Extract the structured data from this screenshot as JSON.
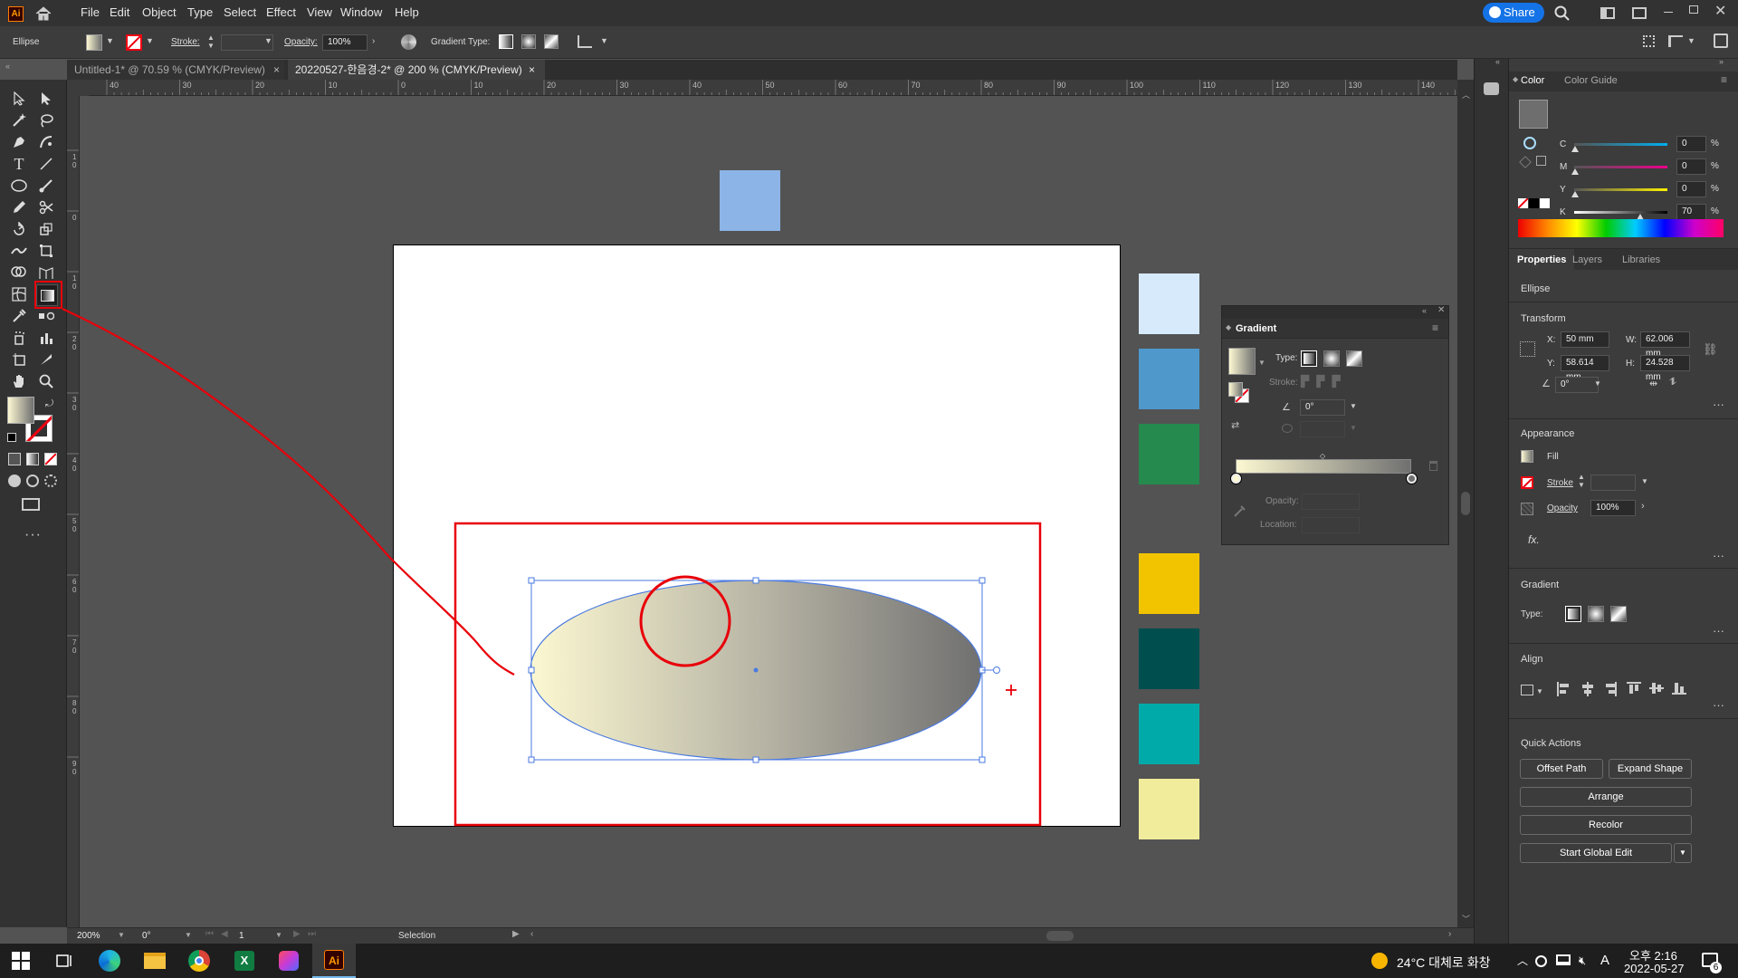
{
  "app": {
    "logo": "Ai",
    "doc_name": "Ellipse"
  },
  "menu": [
    "File",
    "Edit",
    "Object",
    "Type",
    "Select",
    "Effect",
    "View",
    "Window",
    "Help"
  ],
  "share_label": "Share",
  "control": {
    "object": "Ellipse",
    "stroke_label": "Stroke:",
    "opacity_label": "Opacity:",
    "opacity_value": "100%",
    "gradient_type_label": "Gradient Type:"
  },
  "tabs": [
    {
      "label": "Untitled-1* @ 70.59 % (CMYK/Preview)",
      "close": "×"
    },
    {
      "label": "20220527-한음경-2* @ 200 % (CMYK/Preview)",
      "close": "×"
    }
  ],
  "ruler_h": [
    "40",
    "30",
    "20",
    "10",
    "0",
    "10",
    "20",
    "30",
    "40",
    "50",
    "60",
    "70",
    "80",
    "90",
    "100",
    "110",
    "120",
    "130",
    "140"
  ],
  "ruler_v": [
    "1\n0",
    "0",
    "1\n0",
    "2\n0",
    "3\n0",
    "4\n0",
    "5\n0",
    "6\n0",
    "7\n0",
    "8\n0",
    "9\n0"
  ],
  "swatches": [
    "#8cb4e6",
    "#d6eafc",
    "#4e98cc",
    "#258a4e",
    "#f2c400",
    "#004e4e",
    "#00aaa8",
    "#f0ec9c"
  ],
  "gradient_panel": {
    "title": "Gradient",
    "type_label": "Type:",
    "stroke_label": "Stroke:",
    "angle_value": "0°",
    "opacity_label": "Opacity:",
    "location_label": "Location:",
    "start_color": "#fcf8d2",
    "end_color": "#707070"
  },
  "status": {
    "zoom": "200%",
    "rotate": "0°",
    "artboard": "1",
    "mode": "Selection"
  },
  "color_panel": {
    "tabs": [
      "Color",
      "Color Guide"
    ],
    "channels": [
      {
        "name": "C",
        "value": "0",
        "unit": "%"
      },
      {
        "name": "M",
        "value": "0",
        "unit": "%"
      },
      {
        "name": "Y",
        "value": "0",
        "unit": "%"
      },
      {
        "name": "K",
        "value": "70",
        "unit": "%"
      }
    ],
    "swatch_color": "#6e6e6e"
  },
  "properties": {
    "tabs": [
      "Properties",
      "Layers",
      "Libraries"
    ],
    "object": "Ellipse",
    "transform_title": "Transform",
    "x_label": "X:",
    "x_value": "50 mm",
    "y_label": "Y:",
    "y_value": "58.614 mm",
    "w_label": "W:",
    "w_value": "62.006 mm",
    "h_label": "H:",
    "h_value": "24.528 mm",
    "angle_value": "0°",
    "appearance_title": "Appearance",
    "fill_label": "Fill",
    "stroke_label": "Stroke",
    "opacity_label": "Opacity",
    "opacity_value": "100%",
    "fx_label": "fx.",
    "gradient_title": "Gradient",
    "type_label": "Type:",
    "align_title": "Align",
    "quick_actions_title": "Quick Actions",
    "offset_path": "Offset Path",
    "expand_shape": "Expand Shape",
    "arrange": "Arrange",
    "recolor": "Recolor",
    "start_global_edit": "Start Global Edit"
  },
  "taskbar": {
    "weather": "24°C 대체로 화창",
    "time": "오후 2:16",
    "date": "2022-05-27",
    "ime": "A",
    "notifications": "6"
  }
}
